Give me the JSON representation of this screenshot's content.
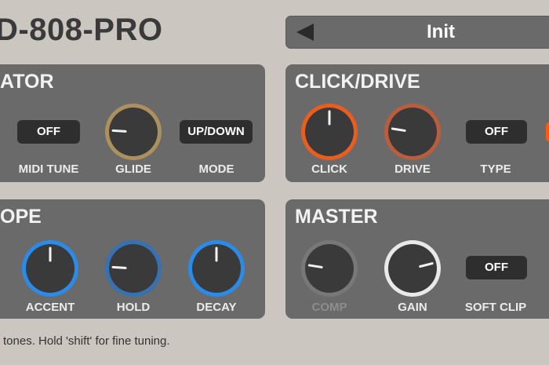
{
  "header": {
    "title": "D-808-PRO"
  },
  "preset": {
    "name": "Init",
    "prev_icon": "left-triangle-icon"
  },
  "oscillator": {
    "title": "ATOR",
    "midi_tune": {
      "label": "MIDI TUNE",
      "state": "OFF"
    },
    "glide": {
      "label": "GLIDE",
      "value": 0.18,
      "ring_color": "#b7965a"
    },
    "mode": {
      "label": "MODE",
      "state": "UP/DOWN"
    }
  },
  "click_drive": {
    "title": "CLICK/DRIVE",
    "click": {
      "label": "CLICK",
      "value": 0.5,
      "ring_color": "#ff5a0f"
    },
    "drive": {
      "label": "DRIVE",
      "value": 0.2,
      "ring_color": "#c75a35"
    },
    "type": {
      "label": "TYPE",
      "state": "OFF"
    }
  },
  "envelope": {
    "title": "OPE",
    "accent": {
      "label": "ACCENT",
      "value": 0.5,
      "ring_color": "#1e90ff"
    },
    "hold": {
      "label": "HOLD",
      "value": 0.18,
      "ring_color": "#2b73c0"
    },
    "decay": {
      "label": "DECAY",
      "value": 0.5,
      "ring_color": "#1e90ff"
    }
  },
  "master": {
    "title": "MASTER",
    "comp": {
      "label": "COMP",
      "value": 0.2,
      "ring_color": "#7a7a7a"
    },
    "gain": {
      "label": "GAIN",
      "value": 0.78,
      "ring_color": "#ffffff"
    },
    "soft_clip": {
      "label": "SOFT CLIP",
      "state": "OFF"
    }
  },
  "footer": {
    "hint": "tones. Hold 'shift' for fine tuning."
  }
}
